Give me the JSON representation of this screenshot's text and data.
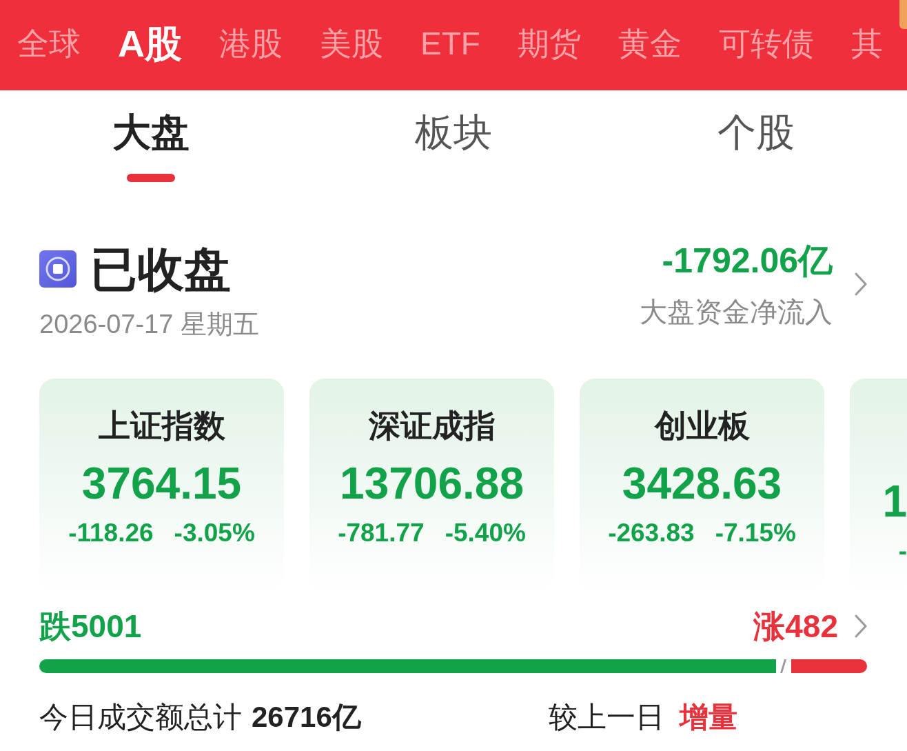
{
  "market_tabs": [
    {
      "label": "全球",
      "selected": false
    },
    {
      "label": "A股",
      "selected": true
    },
    {
      "label": "港股",
      "selected": false
    },
    {
      "label": "美股",
      "selected": false
    },
    {
      "label": "ETF",
      "selected": false
    },
    {
      "label": "期货",
      "selected": false
    },
    {
      "label": "黄金",
      "selected": false
    },
    {
      "label": "可转债",
      "selected": false
    },
    {
      "label": "其",
      "selected": false
    }
  ],
  "view_tabs": [
    {
      "label": "大盘",
      "selected": true
    },
    {
      "label": "板块",
      "selected": false
    },
    {
      "label": "个股",
      "selected": false
    }
  ],
  "market_status": {
    "label": "已收盘",
    "date": "2026-07-17 星期五"
  },
  "net_inflow": {
    "value": "-1792.06亿",
    "label": "大盘资金净流入",
    "rising": false
  },
  "indices": [
    {
      "kind": "full",
      "name": "上证指数",
      "value": "3764.15",
      "change": "-118.26",
      "change_pct": "-3.05%",
      "rising": false
    },
    {
      "kind": "full",
      "name": "深证成指",
      "value": "13706.88",
      "change": "-781.77",
      "change_pct": "-5.40%",
      "rising": false
    },
    {
      "kind": "full",
      "name": "创业板",
      "value": "3428.63",
      "change": "-263.83",
      "change_pct": "-7.15%",
      "rising": false
    },
    {
      "kind": "cut",
      "value": "1",
      "change": "-",
      "rising": false
    }
  ],
  "breadth": {
    "fall_label": "跌5001",
    "rise_label": "涨482",
    "level": 0.89
  },
  "turnover": {
    "label": "今日成交额总计",
    "value": "26716亿",
    "compare_label": "较上一日",
    "change_label": "增量"
  }
}
